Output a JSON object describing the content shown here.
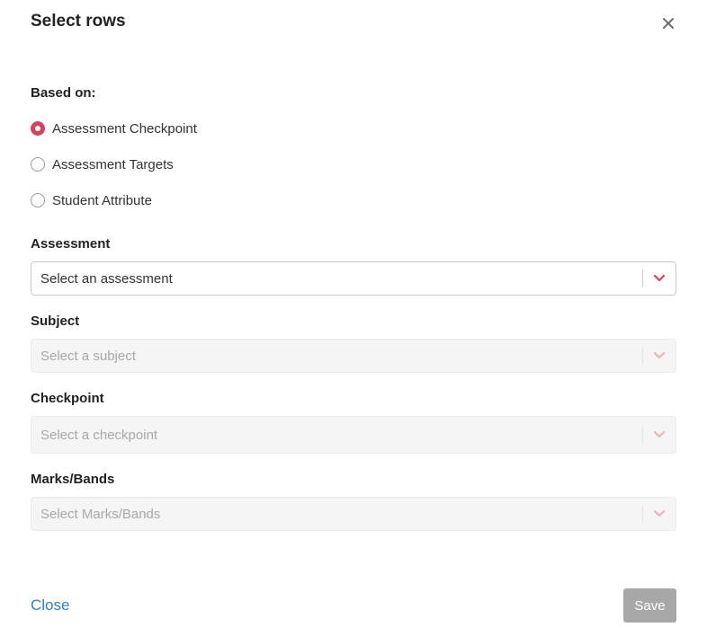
{
  "dialog": {
    "title": "Select rows",
    "close_icon": "close-icon"
  },
  "based_on": {
    "label": "Based on:",
    "options": [
      {
        "label": "Assessment Checkpoint",
        "checked": true
      },
      {
        "label": "Assessment Targets",
        "checked": false
      },
      {
        "label": "Student Attribute",
        "checked": false
      }
    ]
  },
  "assessment": {
    "label": "Assessment",
    "placeholder": "Select an assessment",
    "enabled": true,
    "icon": "chevron-down-icon"
  },
  "subject": {
    "label": "Subject",
    "placeholder": "Select a subject",
    "enabled": false,
    "icon": "chevron-down-icon"
  },
  "checkpoint": {
    "label": "Checkpoint",
    "placeholder": "Select a checkpoint",
    "enabled": false,
    "icon": "chevron-down-icon"
  },
  "marks_bands": {
    "label": "Marks/Bands",
    "placeholder": "Select Marks/Bands",
    "enabled": false,
    "icon": "chevron-down-icon"
  },
  "footer": {
    "close_label": "Close",
    "save_label": "Save",
    "save_enabled": false
  },
  "colors": {
    "accent": "#d4435c",
    "link": "#2f7fc5",
    "button_disabled": "#a8a8a8"
  }
}
